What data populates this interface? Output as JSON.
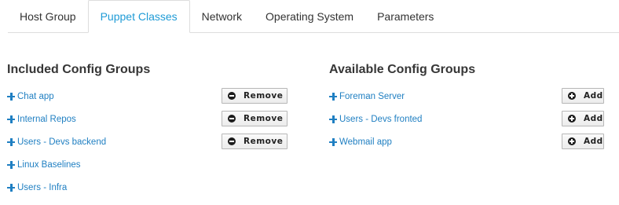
{
  "tabs": [
    {
      "label": "Host Group",
      "active": false
    },
    {
      "label": "Puppet Classes",
      "active": true
    },
    {
      "label": "Network",
      "active": false
    },
    {
      "label": "Operating System",
      "active": false
    },
    {
      "label": "Parameters",
      "active": false
    }
  ],
  "included": {
    "title": "Included Config Groups",
    "button_label": "Remove",
    "items": [
      {
        "label": "Chat app",
        "removable": true
      },
      {
        "label": "Internal Repos",
        "removable": true
      },
      {
        "label": "Users - Devs backend",
        "removable": true
      },
      {
        "label": "Linux Baselines",
        "removable": false
      },
      {
        "label": "Users - Infra",
        "removable": false
      }
    ]
  },
  "available": {
    "title": "Available Config Groups",
    "button_label": "Add",
    "items": [
      {
        "label": "Foreman Server"
      },
      {
        "label": "Users - Devs fronted"
      },
      {
        "label": "Webmail app"
      }
    ]
  },
  "colors": {
    "link": "#1f7fc2",
    "active_tab": "#1f9bd6",
    "border": "#dddddd"
  },
  "icons": {
    "link_icon": "plus-icon",
    "remove_icon": "minus-circle-icon",
    "add_icon": "plus-circle-icon"
  }
}
